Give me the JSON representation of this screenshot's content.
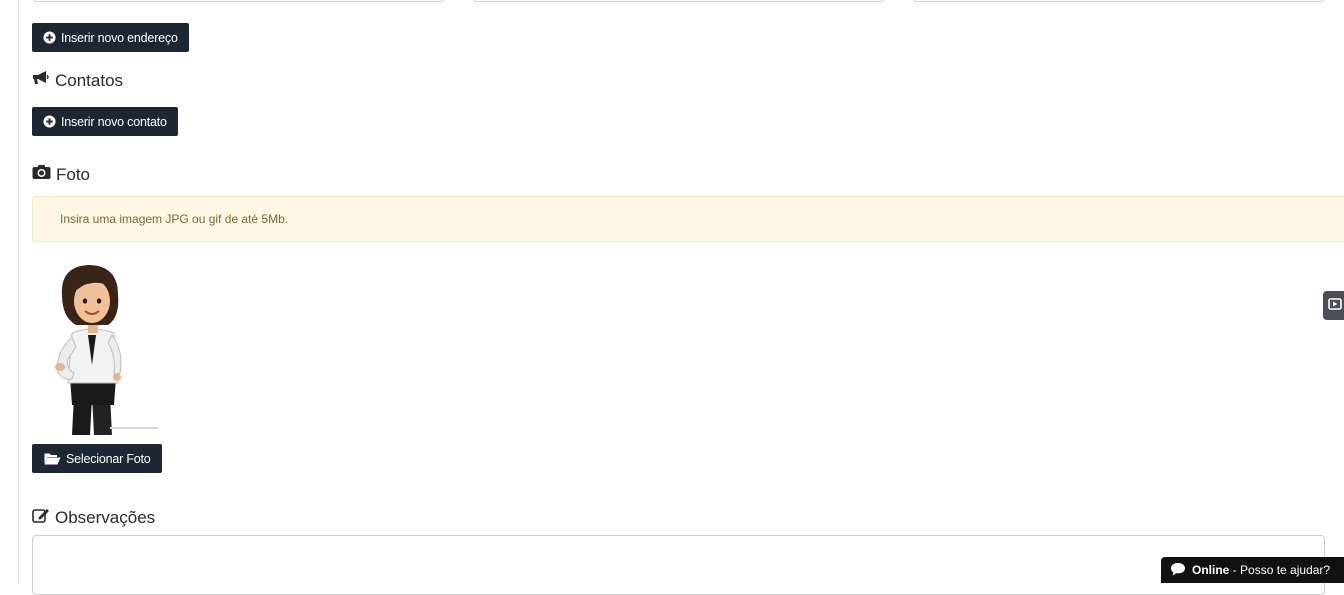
{
  "address": {
    "insert_button": "Inserir novo endereço"
  },
  "contacts": {
    "title": "Contatos",
    "insert_button": "Inserir novo contato"
  },
  "photo": {
    "title": "Foto",
    "notice": "Insira uma imagem JPG ou gif de até 5Mb.",
    "select_button": "Selecionar Foto"
  },
  "observations": {
    "title": "Observações"
  },
  "chat": {
    "status": "Online",
    "separator": " - ",
    "prompt": "Posso te ajudar?"
  },
  "colors": {
    "button_bg": "#1c2733",
    "alert_bg": "#fdf7e3",
    "chat_bg": "#111111"
  },
  "icons": {
    "address_button": "plus-circle-icon",
    "contacts_section": "bullhorn-icon",
    "contacts_button": "plus-circle-icon",
    "photo_section": "camera-icon",
    "photo_button": "folder-open-icon",
    "observations_section": "edit-icon",
    "chat": "chat-bubble-icon",
    "side_tab": "play-icon"
  }
}
